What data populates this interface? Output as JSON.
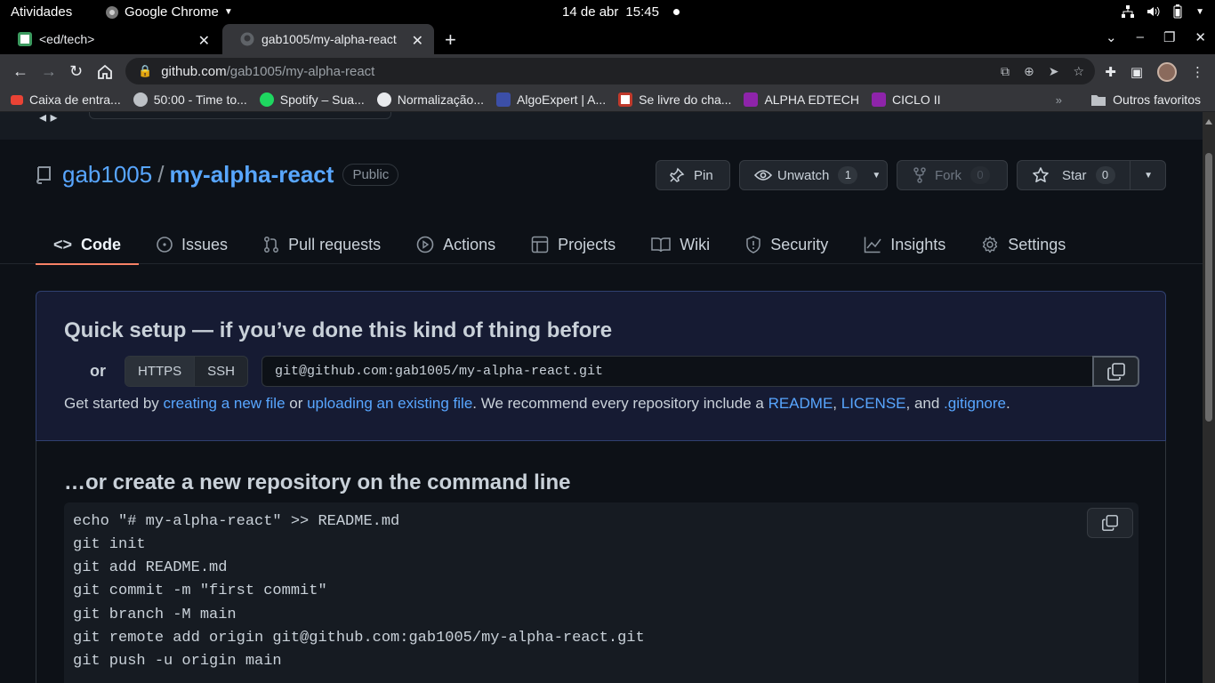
{
  "system": {
    "activities": "Atividades",
    "app_name": "Google Chrome",
    "date": "14 de abr",
    "time": "15:45"
  },
  "browser": {
    "tabs": [
      {
        "title": "<ed/tech>"
      },
      {
        "title": "gab1005/my-alpha-react"
      }
    ],
    "url_host": "github.com",
    "url_path": "/gab1005/my-alpha-react",
    "bookmarks": [
      {
        "label": "Caixa de entra..."
      },
      {
        "label": "50:00 - Time to..."
      },
      {
        "label": "Spotify – Sua..."
      },
      {
        "label": "Normalização..."
      },
      {
        "label": "AlgoExpert | A..."
      },
      {
        "label": "Se livre do cha..."
      },
      {
        "label": "ALPHA EDTECH"
      },
      {
        "label": "CICLO II"
      }
    ],
    "more_bookmarks": "»",
    "other_bookmarks": "Outros favoritos"
  },
  "repo": {
    "owner": "gab1005",
    "separator": "/",
    "name": "my-alpha-react",
    "visibility": "Public",
    "pin_label": "Pin",
    "watch_label": "Unwatch",
    "watch_count": "1",
    "fork_label": "Fork",
    "fork_count": "0",
    "star_label": "Star",
    "star_count": "0",
    "tabs": [
      {
        "label": "Code"
      },
      {
        "label": "Issues"
      },
      {
        "label": "Pull requests"
      },
      {
        "label": "Actions"
      },
      {
        "label": "Projects"
      },
      {
        "label": "Wiki"
      },
      {
        "label": "Security"
      },
      {
        "label": "Insights"
      },
      {
        "label": "Settings"
      }
    ]
  },
  "quick_setup": {
    "title": "Quick setup — if you’ve done this kind of thing before",
    "or": "or",
    "proto_https": "HTTPS",
    "proto_ssh": "SSH",
    "clone_url": "git@github.com:gab1005/my-alpha-react.git",
    "hint_1": "Get started by ",
    "link_new_file": "creating a new file",
    "hint_2": " or ",
    "link_upload": "uploading an existing file",
    "hint_3": ". We recommend every repository include a ",
    "link_readme": "README",
    "hint_4": ", ",
    "link_license": "LICENSE",
    "hint_5": ", and ",
    "link_gitignore": ".gitignore",
    "hint_6": "."
  },
  "command_line": {
    "title": "…or create a new repository on the command line",
    "lines": [
      "echo \"# my-alpha-react\" >> README.md",
      "git init",
      "git add README.md",
      "git commit -m \"first commit\"",
      "git branch -M main",
      "git remote add origin git@github.com:gab1005/my-alpha-react.git",
      "git push -u origin main"
    ]
  },
  "colors": {
    "accent_link": "#58a6ff",
    "active_tab_underline": "#f78166",
    "page_bg": "#0d1117"
  }
}
